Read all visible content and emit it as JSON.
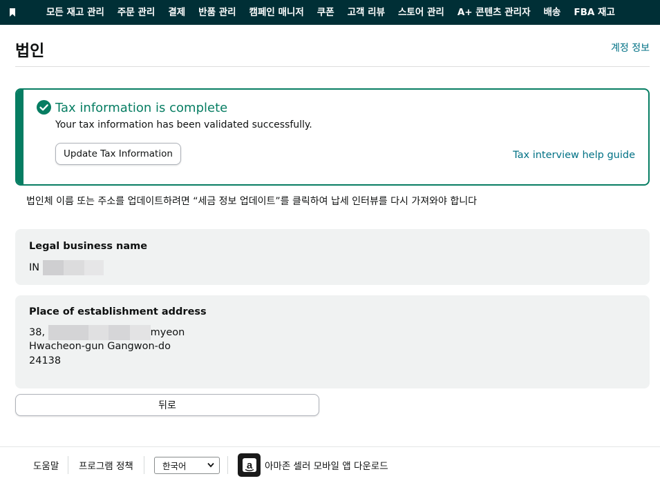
{
  "nav": {
    "bookmark_icon": "bookmark-icon",
    "items": [
      "모든 재고 관리",
      "주문 관리",
      "결제",
      "반품 관리",
      "캠페인 매니저",
      "쿠폰",
      "고객 리뷰",
      "스토어 관리",
      "A+ 콘텐츠 관리자",
      "배송",
      "FBA 재고"
    ]
  },
  "header": {
    "title": "법인",
    "account_link": "계정 정보"
  },
  "alert": {
    "icon": "check-circle-icon",
    "title": "Tax information is complete",
    "text": "Your tax information has been validated successfully.",
    "update_button": "Update Tax Information",
    "help_link": "Tax interview help guide"
  },
  "note": "법인체 이름 또는 주소를 업데이트하려면 “세금 정보 업데이트”를 클릭하여 납세 인터뷰를 다시 가져와야 합니다",
  "legal_name": {
    "label": "Legal business name",
    "prefix": "IN"
  },
  "address": {
    "label": "Place of establishment address",
    "line1_prefix": "38,",
    "line1_suffix": "myeon",
    "line2": "Hwacheon-gun Gangwon-do",
    "line3": "24138"
  },
  "back_button": "뒤로",
  "footer": {
    "help": "도움말",
    "policy": "프로그램 정책",
    "language": "한국어",
    "app_link": "아마존 셀러 모바일 앱 다운로드"
  },
  "colors": {
    "nav_bg": "#002f36",
    "success": "#067d62",
    "link": "#007185",
    "card_bg": "#f0f2f2"
  }
}
